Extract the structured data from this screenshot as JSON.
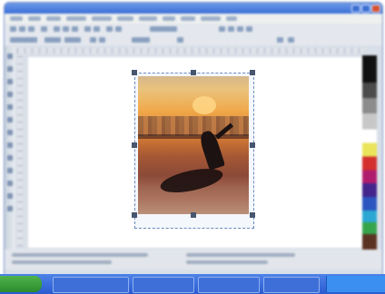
{
  "app": {
    "window_title": "",
    "menu_items": [
      "",
      "",
      "",
      "",
      "",
      "",
      "",
      "",
      "",
      "",
      ""
    ],
    "toolbar_rows": 2
  },
  "document": {
    "image_description_icon": "photo-thumbnail"
  },
  "colors": {
    "title_bar": "#3a6fd8",
    "taskbar": "#2a5bd0",
    "start_button": "#2c8b2c",
    "selection_frame": "#6b8bbf"
  },
  "palette": {
    "swatches": [
      "#111111",
      "#4b4b4b",
      "#8c8c8c",
      "#c7c7c7",
      "#ffffff",
      "#e9e45a",
      "#d3302e",
      "#b01c6d",
      "#43258c",
      "#2c55bf",
      "#2ca7d3",
      "#36a54b",
      "#5b3322"
    ]
  },
  "taskbar": {
    "start_label": "",
    "items": [
      "",
      "",
      "",
      ""
    ],
    "clock": ""
  }
}
